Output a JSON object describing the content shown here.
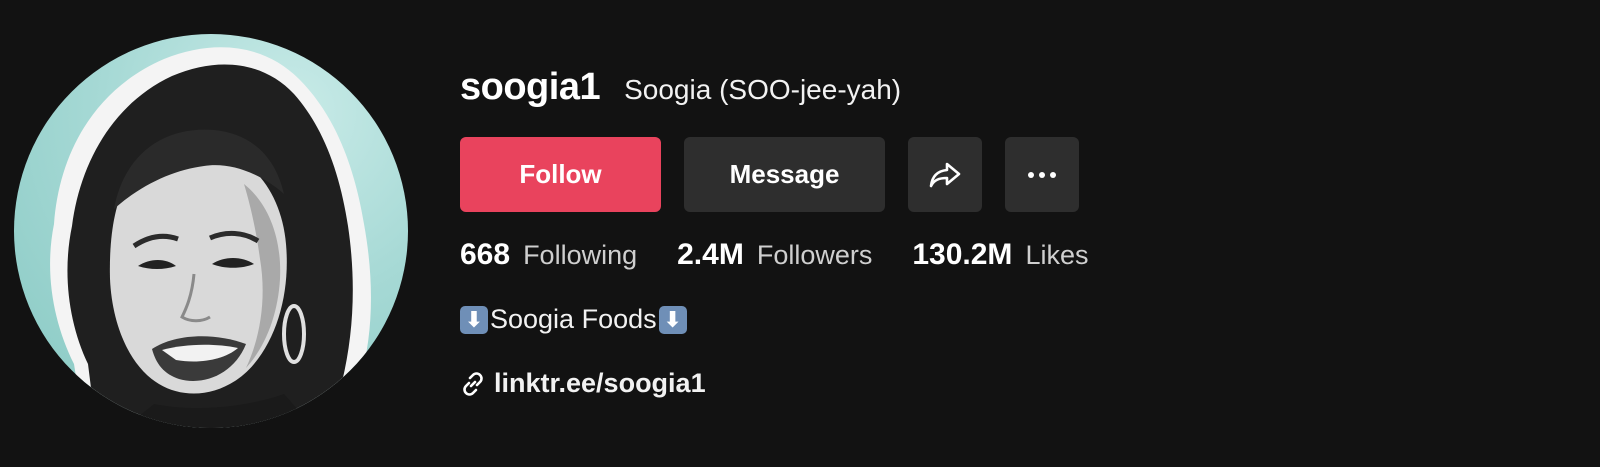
{
  "profile": {
    "username": "soogia1",
    "nickname": "Soogia (SOO-jee-yah)"
  },
  "actions": {
    "follow_label": "Follow",
    "message_label": "Message",
    "share_icon": "share-arrow-icon",
    "more_icon": "more-dots-icon"
  },
  "stats": {
    "following_count": "668",
    "following_label": "Following",
    "followers_count": "2.4M",
    "followers_label": "Followers",
    "likes_count": "130.2M",
    "likes_label": "Likes"
  },
  "bio": {
    "left_emoji": "⬇",
    "text": "Soogia Foods",
    "right_emoji": "⬇"
  },
  "link": {
    "url_text": "linktr.ee/soogia1",
    "icon": "link-icon"
  },
  "colors": {
    "background": "#121212",
    "follow_button": "#e9435d",
    "secondary_button": "#2e2e2e",
    "avatar_backdrop": "#a6d9d5"
  }
}
